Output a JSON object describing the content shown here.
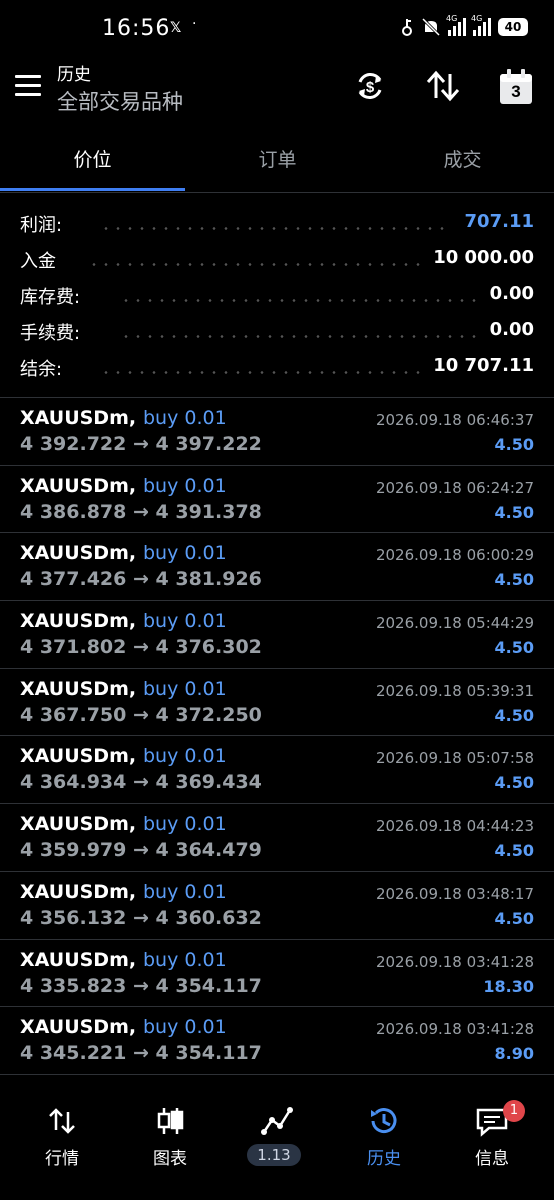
{
  "status": {
    "time": "16:56",
    "x_label": "𝕏",
    "dot": "·",
    "net1": "4G",
    "net2": "4G",
    "battery": "40"
  },
  "header": {
    "title": "历史",
    "subtitle": "全部交易品种",
    "calendar_day": "3"
  },
  "tabs": [
    {
      "label": "价位"
    },
    {
      "label": "订单"
    },
    {
      "label": "成交"
    }
  ],
  "summary": [
    {
      "label": "利润:",
      "value": "707.11",
      "highlight": true
    },
    {
      "label": "入金",
      "value": "10 000.00",
      "highlight": false
    },
    {
      "label": "库存费:",
      "value": "0.00",
      "highlight": false
    },
    {
      "label": "手续费:",
      "value": "0.00",
      "highlight": false
    },
    {
      "label": "结余:",
      "value": "10 707.11",
      "highlight": false
    }
  ],
  "trades": [
    {
      "symbol": "XAUUSDm,",
      "side": "buy 0.01",
      "prices": "4 392.722 → 4 397.222",
      "time": "2026.09.18 06:46:37",
      "profit": "4.50"
    },
    {
      "symbol": "XAUUSDm,",
      "side": "buy 0.01",
      "prices": "4 386.878 → 4 391.378",
      "time": "2026.09.18 06:24:27",
      "profit": "4.50"
    },
    {
      "symbol": "XAUUSDm,",
      "side": "buy 0.01",
      "prices": "4 377.426 → 4 381.926",
      "time": "2026.09.18 06:00:29",
      "profit": "4.50"
    },
    {
      "symbol": "XAUUSDm,",
      "side": "buy 0.01",
      "prices": "4 371.802 → 4 376.302",
      "time": "2026.09.18 05:44:29",
      "profit": "4.50"
    },
    {
      "symbol": "XAUUSDm,",
      "side": "buy 0.01",
      "prices": "4 367.750 → 4 372.250",
      "time": "2026.09.18 05:39:31",
      "profit": "4.50"
    },
    {
      "symbol": "XAUUSDm,",
      "side": "buy 0.01",
      "prices": "4 364.934 → 4 369.434",
      "time": "2026.09.18 05:07:58",
      "profit": "4.50"
    },
    {
      "symbol": "XAUUSDm,",
      "side": "buy 0.01",
      "prices": "4 359.979 → 4 364.479",
      "time": "2026.09.18 04:44:23",
      "profit": "4.50"
    },
    {
      "symbol": "XAUUSDm,",
      "side": "buy 0.01",
      "prices": "4 356.132 → 4 360.632",
      "time": "2026.09.18 03:48:17",
      "profit": "4.50"
    },
    {
      "symbol": "XAUUSDm,",
      "side": "buy 0.01",
      "prices": "4 335.823 → 4 354.117",
      "time": "2026.09.18 03:41:28",
      "profit": "18.30"
    },
    {
      "symbol": "XAUUSDm,",
      "side": "buy 0.01",
      "prices": "4 345.221 → 4 354.117",
      "time": "2026.09.18 03:41:28",
      "profit": "8.90"
    }
  ],
  "nav": [
    {
      "label": "行情",
      "icon": "quotes-icon"
    },
    {
      "label": "图表",
      "icon": "candlestick-chart-icon"
    },
    {
      "label": "1.13",
      "icon": "trade-line-icon",
      "pill": true
    },
    {
      "label": "历史",
      "icon": "history-clock-icon",
      "active": true
    },
    {
      "label": "信息",
      "icon": "chat-bubble-icon",
      "badge": "1"
    }
  ],
  "colors": {
    "accent": "#3f7ef2",
    "profit": "#5b9cf5",
    "badge": "#e0464a"
  }
}
